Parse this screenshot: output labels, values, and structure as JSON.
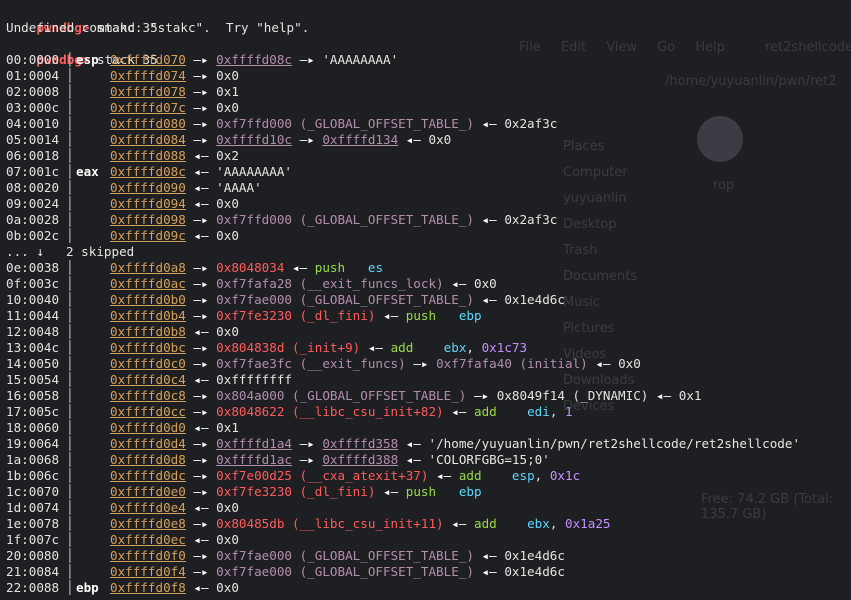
{
  "header_lines": [
    {
      "prompt": "pwndbg>",
      "cmd": " stakc 35"
    },
    {
      "text": "Undefined command: \"stakc\".  Try \"help\"."
    },
    {
      "prompt": "pwndbg>",
      "cmd": " stack 35"
    }
  ],
  "skip_line": {
    "off": "... ↓",
    "text": "2 skipped"
  },
  "rows": [
    {
      "off": "00:0000",
      "reg": "esp",
      "addr": "0xffffd070",
      "parts": [
        [
          "arr",
          " —▸ "
        ],
        [
          "heap",
          "0xffffd08c"
        ],
        [
          "arr",
          " —▸ "
        ],
        [
          "str",
          "'AAAAAAAA'"
        ]
      ]
    },
    {
      "off": "01:0004",
      "reg": "",
      "addr": "0xffffd074",
      "parts": [
        [
          "arr",
          " —▸ "
        ],
        [
          "plain",
          "0x0"
        ]
      ]
    },
    {
      "off": "02:0008",
      "reg": "",
      "addr": "0xffffd078",
      "parts": [
        [
          "arr",
          " —▸ "
        ],
        [
          "plain",
          "0x1"
        ]
      ]
    },
    {
      "off": "03:000c",
      "reg": "",
      "addr": "0xffffd07c",
      "parts": [
        [
          "arr",
          " —▸ "
        ],
        [
          "plain",
          "0x0"
        ]
      ]
    },
    {
      "off": "04:0010",
      "reg": "",
      "addr": "0xffffd080",
      "parts": [
        [
          "arr",
          " —▸ "
        ],
        [
          "sym",
          "0xf7ffd000 (_GLOBAL_OFFSET_TABLE_)"
        ],
        [
          "arr",
          " ◂— "
        ],
        [
          "plain",
          "0x2af3c"
        ]
      ]
    },
    {
      "off": "05:0014",
      "reg": "",
      "addr": "0xffffd084",
      "parts": [
        [
          "arr",
          " —▸ "
        ],
        [
          "heap",
          "0xffffd10c"
        ],
        [
          "arr",
          " —▸ "
        ],
        [
          "heap",
          "0xffffd134"
        ],
        [
          "arr",
          " ◂— "
        ],
        [
          "plain",
          "0x0"
        ]
      ]
    },
    {
      "off": "06:0018",
      "reg": "",
      "addr": "0xffffd088",
      "parts": [
        [
          "arr",
          " ◂— "
        ],
        [
          "plain",
          "0x2"
        ]
      ]
    },
    {
      "off": "07:001c",
      "reg": "eax",
      "addr": "0xffffd08c",
      "parts": [
        [
          "arr",
          " ◂— "
        ],
        [
          "str",
          "'AAAAAAAA'"
        ]
      ]
    },
    {
      "off": "08:0020",
      "reg": "",
      "addr": "0xffffd090",
      "parts": [
        [
          "arr",
          " ◂— "
        ],
        [
          "str",
          "'AAAA'"
        ]
      ]
    },
    {
      "off": "09:0024",
      "reg": "",
      "addr": "0xffffd094",
      "parts": [
        [
          "arr",
          " ◂— "
        ],
        [
          "plain",
          "0x0"
        ]
      ]
    },
    {
      "off": "0a:0028",
      "reg": "",
      "addr": "0xffffd098",
      "parts": [
        [
          "arr",
          " —▸ "
        ],
        [
          "sym",
          "0xf7ffd000 (_GLOBAL_OFFSET_TABLE_)"
        ],
        [
          "arr",
          " ◂— "
        ],
        [
          "plain",
          "0x2af3c"
        ]
      ]
    },
    {
      "off": "0b:002c",
      "reg": "",
      "addr": "0xffffd09c",
      "parts": [
        [
          "arr",
          " ◂— "
        ],
        [
          "plain",
          "0x0"
        ]
      ]
    },
    {
      "skip": true
    },
    {
      "off": "0e:0038",
      "reg": "",
      "addr": "0xffffd0a8",
      "parts": [
        [
          "arr",
          " —▸ "
        ],
        [
          "code",
          "0x8048034"
        ],
        [
          "arr",
          " ◂— "
        ],
        [
          "ins",
          "push"
        ],
        [
          "plain",
          "   "
        ],
        [
          "rega",
          "es"
        ]
      ]
    },
    {
      "off": "0f:003c",
      "reg": "",
      "addr": "0xffffd0ac",
      "parts": [
        [
          "arr",
          " —▸ "
        ],
        [
          "sym",
          "0xf7fafa28 (__exit_funcs_lock)"
        ],
        [
          "arr",
          " ◂— "
        ],
        [
          "plain",
          "0x0"
        ]
      ]
    },
    {
      "off": "10:0040",
      "reg": "",
      "addr": "0xffffd0b0",
      "parts": [
        [
          "arr",
          " —▸ "
        ],
        [
          "sym",
          "0xf7fae000 (_GLOBAL_OFFSET_TABLE_)"
        ],
        [
          "arr",
          " ◂— "
        ],
        [
          "plain",
          "0x1e4d6c"
        ]
      ]
    },
    {
      "off": "11:0044",
      "reg": "",
      "addr": "0xffffd0b4",
      "parts": [
        [
          "arr",
          " —▸ "
        ],
        [
          "code",
          "0xf7fe3230 (_dl_fini)"
        ],
        [
          "arr",
          " ◂— "
        ],
        [
          "ins",
          "push"
        ],
        [
          "plain",
          "   "
        ],
        [
          "rega",
          "ebp"
        ]
      ]
    },
    {
      "off": "12:0048",
      "reg": "",
      "addr": "0xffffd0b8",
      "parts": [
        [
          "arr",
          " ◂— "
        ],
        [
          "plain",
          "0x0"
        ]
      ]
    },
    {
      "off": "13:004c",
      "reg": "",
      "addr": "0xffffd0bc",
      "parts": [
        [
          "arr",
          " —▸ "
        ],
        [
          "code",
          "0x804838d (_init+9)"
        ],
        [
          "arr",
          " ◂— "
        ],
        [
          "ins",
          "add"
        ],
        [
          "plain",
          "    "
        ],
        [
          "rega",
          "ebx"
        ],
        [
          "plain",
          ", "
        ],
        [
          "num",
          "0x1c73"
        ]
      ]
    },
    {
      "off": "14:0050",
      "reg": "",
      "addr": "0xffffd0c0",
      "parts": [
        [
          "arr",
          " —▸ "
        ],
        [
          "sym",
          "0xf7fae3fc (__exit_funcs)"
        ],
        [
          "arr",
          " —▸ "
        ],
        [
          "sym",
          "0xf7fafa40 (initial)"
        ],
        [
          "arr",
          " ◂— "
        ],
        [
          "plain",
          "0x0"
        ]
      ]
    },
    {
      "off": "15:0054",
      "reg": "",
      "addr": "0xffffd0c4",
      "parts": [
        [
          "arr",
          " ◂— "
        ],
        [
          "plain",
          "0xffffffff"
        ]
      ]
    },
    {
      "off": "16:0058",
      "reg": "",
      "addr": "0xffffd0c8",
      "parts": [
        [
          "arr",
          " —▸ "
        ],
        [
          "sym",
          "0x804a000 (_GLOBAL_OFFSET_TABLE_)"
        ],
        [
          "arr",
          " —▸ "
        ],
        [
          "plain",
          "0x8049f14 (_DYNAMIC)"
        ],
        [
          "arr",
          " ◂— "
        ],
        [
          "plain",
          "0x1"
        ]
      ]
    },
    {
      "off": "17:005c",
      "reg": "",
      "addr": "0xffffd0cc",
      "parts": [
        [
          "arr",
          " —▸ "
        ],
        [
          "code",
          "0x8048622 (__libc_csu_init+82)"
        ],
        [
          "arr",
          " ◂— "
        ],
        [
          "ins",
          "add"
        ],
        [
          "plain",
          "    "
        ],
        [
          "rega",
          "edi"
        ],
        [
          "plain",
          ", "
        ],
        [
          "num",
          "1"
        ]
      ]
    },
    {
      "off": "18:0060",
      "reg": "",
      "addr": "0xffffd0d0",
      "parts": [
        [
          "arr",
          " ◂— "
        ],
        [
          "plain",
          "0x1"
        ]
      ]
    },
    {
      "off": "19:0064",
      "reg": "",
      "addr": "0xffffd0d4",
      "parts": [
        [
          "arr",
          " —▸ "
        ],
        [
          "heap",
          "0xffffd1a4"
        ],
        [
          "arr",
          " —▸ "
        ],
        [
          "heap",
          "0xffffd358"
        ],
        [
          "arr",
          " ◂— "
        ],
        [
          "str",
          "'/home/yuyuanlin/pwn/ret2shellcode/ret2shellcode'"
        ]
      ]
    },
    {
      "off": "1a:0068",
      "reg": "",
      "addr": "0xffffd0d8",
      "parts": [
        [
          "arr",
          " —▸ "
        ],
        [
          "heap",
          "0xffffd1ac"
        ],
        [
          "arr",
          " —▸ "
        ],
        [
          "heap",
          "0xffffd388"
        ],
        [
          "arr",
          " ◂— "
        ],
        [
          "str",
          "'COLORFGBG=15;0'"
        ]
      ]
    },
    {
      "off": "1b:006c",
      "reg": "",
      "addr": "0xffffd0dc",
      "parts": [
        [
          "arr",
          " —▸ "
        ],
        [
          "code",
          "0xf7e00d25 (__cxa_atexit+37)"
        ],
        [
          "arr",
          " ◂— "
        ],
        [
          "ins",
          "add"
        ],
        [
          "plain",
          "    "
        ],
        [
          "rega",
          "esp"
        ],
        [
          "plain",
          ", "
        ],
        [
          "num",
          "0x1c"
        ]
      ]
    },
    {
      "off": "1c:0070",
      "reg": "",
      "addr": "0xffffd0e0",
      "parts": [
        [
          "arr",
          " —▸ "
        ],
        [
          "code",
          "0xf7fe3230 (_dl_fini)"
        ],
        [
          "arr",
          " ◂— "
        ],
        [
          "ins",
          "push"
        ],
        [
          "plain",
          "   "
        ],
        [
          "rega",
          "ebp"
        ]
      ]
    },
    {
      "off": "1d:0074",
      "reg": "",
      "addr": "0xffffd0e4",
      "parts": [
        [
          "arr",
          " ◂— "
        ],
        [
          "plain",
          "0x0"
        ]
      ]
    },
    {
      "off": "1e:0078",
      "reg": "",
      "addr": "0xffffd0e8",
      "parts": [
        [
          "arr",
          " —▸ "
        ],
        [
          "code",
          "0x80485db (__libc_csu_init+11)"
        ],
        [
          "arr",
          " ◂— "
        ],
        [
          "ins",
          "add"
        ],
        [
          "plain",
          "    "
        ],
        [
          "rega",
          "ebx"
        ],
        [
          "plain",
          ", "
        ],
        [
          "num",
          "0x1a25"
        ]
      ]
    },
    {
      "off": "1f:007c",
      "reg": "",
      "addr": "0xffffd0ec",
      "parts": [
        [
          "arr",
          " ◂— "
        ],
        [
          "plain",
          "0x0"
        ]
      ]
    },
    {
      "off": "20:0080",
      "reg": "",
      "addr": "0xffffd0f0",
      "parts": [
        [
          "arr",
          " —▸ "
        ],
        [
          "sym",
          "0xf7fae000 (_GLOBAL_OFFSET_TABLE_)"
        ],
        [
          "arr",
          " ◂— "
        ],
        [
          "plain",
          "0x1e4d6c"
        ]
      ]
    },
    {
      "off": "21:0084",
      "reg": "",
      "addr": "0xffffd0f4",
      "parts": [
        [
          "arr",
          " —▸ "
        ],
        [
          "sym",
          "0xf7fae000 (_GLOBAL_OFFSET_TABLE_)"
        ],
        [
          "arr",
          " ◂— "
        ],
        [
          "plain",
          "0x1e4d6c"
        ]
      ]
    },
    {
      "off": "22:0088",
      "reg": "ebp",
      "addr": "0xffffd0f8",
      "parts": [
        [
          "arr",
          " ◂— "
        ],
        [
          "plain",
          "0x0"
        ]
      ]
    }
  ],
  "ghost": {
    "title": "ret2shellcode",
    "menu": "File Edit View Go Help",
    "path": "/home/yuyuanlin/pwn/ret2",
    "places": [
      "Places",
      "Computer",
      "yuyuanlin",
      "Desktop",
      "Trash",
      "Documents",
      "Music",
      "Pictures",
      "Videos",
      "Downloads",
      "Devices"
    ],
    "folder": "rop",
    "free": "Free: 74.2 GB (Total: 135.7 GB)"
  },
  "colors": {
    "background": "#1d1f22",
    "prompt": "#ff5f5f",
    "address": "#d6a05a",
    "symbol": "#b48ead",
    "code": "#ff5b5b",
    "instruction": "#9bd94b",
    "register": "#5fd7ff"
  }
}
